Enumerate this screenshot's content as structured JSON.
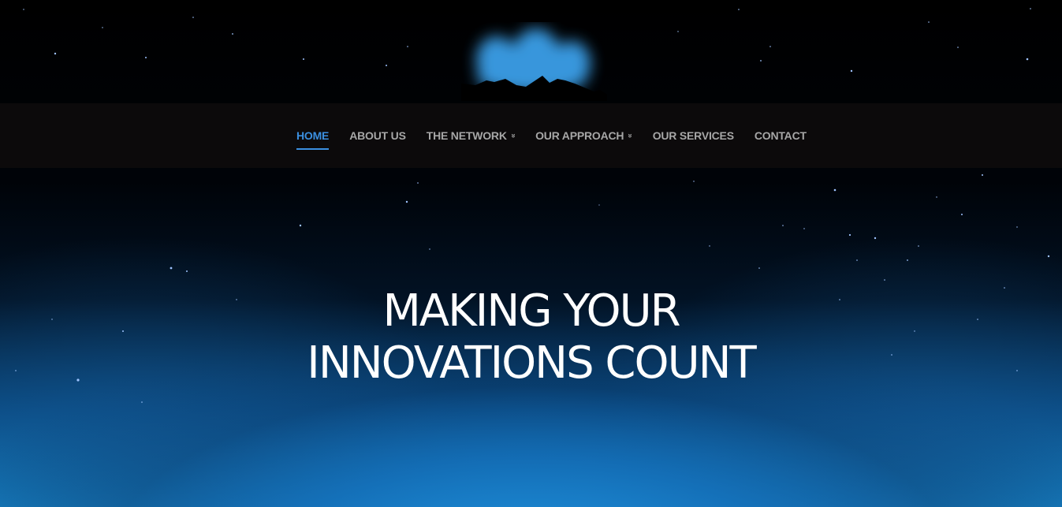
{
  "colors": {
    "nav_background": "#0c0a0b",
    "nav_text": "#a7a7a7",
    "nav_active": "#3b8fe0",
    "hero_text": "#ffffff",
    "sky_bottom": "#1683c6"
  },
  "logo": {
    "icon": "mountain-aurora-icon"
  },
  "nav": {
    "items": [
      {
        "label": "HOME",
        "active": true
      },
      {
        "label": "ABOUT US"
      },
      {
        "label": "THE NETWORK",
        "dropdown": true
      },
      {
        "label": "OUR APPROACH",
        "dropdown": true
      },
      {
        "label": "OUR SERVICES"
      },
      {
        "label": "CONTACT"
      }
    ],
    "dropdown_icon": "double-chevron-down-icon"
  },
  "hero": {
    "line1": "MAKING YOUR",
    "line2": "INNOVATIONS COUNT"
  }
}
